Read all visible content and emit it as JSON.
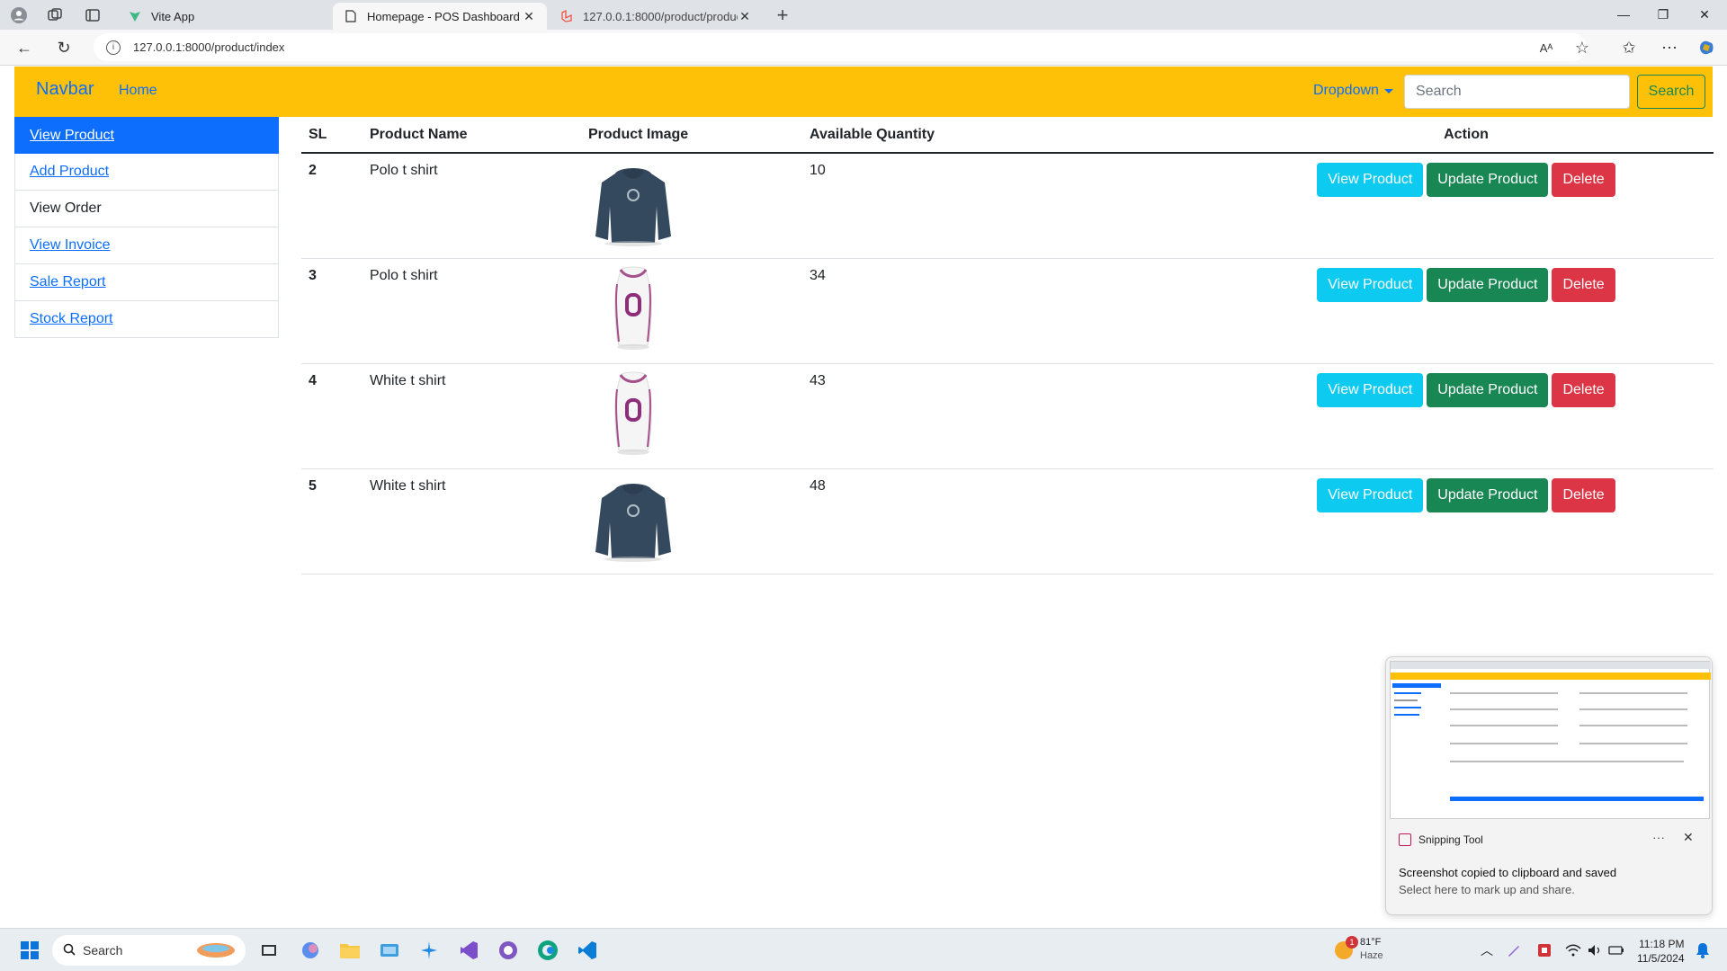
{
  "browser": {
    "tabs": [
      {
        "title": "Vite App",
        "active": false
      },
      {
        "title": "Homepage - POS Dashboard",
        "active": true
      },
      {
        "title": "127.0.0.1:8000/product/productlis",
        "active": false
      }
    ],
    "url": "127.0.0.1:8000/product/index"
  },
  "navbar": {
    "brand": "Navbar",
    "home": "Home",
    "dropdown": "Dropdown",
    "search_placeholder": "Search",
    "search_button": "Search"
  },
  "sidebar": {
    "items": [
      {
        "label": "View Product",
        "active": true,
        "link": true
      },
      {
        "label": "Add Product",
        "active": false,
        "link": true
      },
      {
        "label": "View Order",
        "active": false,
        "link": false
      },
      {
        "label": "View Invoice",
        "active": false,
        "link": true
      },
      {
        "label": "Sale Report",
        "active": false,
        "link": true
      },
      {
        "label": "Stock Report",
        "active": false,
        "link": true
      }
    ]
  },
  "table": {
    "headers": {
      "sl": "SL",
      "name": "Product Name",
      "image": "Product Image",
      "qty": "Available Quantity",
      "action": "Action"
    },
    "action_labels": {
      "view": "View Product",
      "update": "Update Product",
      "delete": "Delete"
    },
    "rows": [
      {
        "sl": "2",
        "name": "Polo t shirt",
        "image": "navy-hoodie",
        "qty": "10"
      },
      {
        "sl": "3",
        "name": "Polo t shirt",
        "image": "white-jersey",
        "qty": "34"
      },
      {
        "sl": "4",
        "name": "White t shirt",
        "image": "white-jersey",
        "qty": "43"
      },
      {
        "sl": "5",
        "name": "White t shirt",
        "image": "navy-hoodie",
        "qty": "48"
      }
    ]
  },
  "toast": {
    "app": "Snipping Tool",
    "message": "Screenshot copied to clipboard and saved",
    "sub": "Select here to mark up and share."
  },
  "taskbar": {
    "search": "Search",
    "weather_temp": "81°F",
    "weather_desc": "Haze",
    "weather_badge": "1",
    "time": "11:18 PM",
    "date": "11/5/2024"
  },
  "colors": {
    "navbar_bg": "#ffc107",
    "primary": "#0d6efd",
    "info": "#0dcaf0",
    "success": "#198754",
    "danger": "#dc3545"
  }
}
